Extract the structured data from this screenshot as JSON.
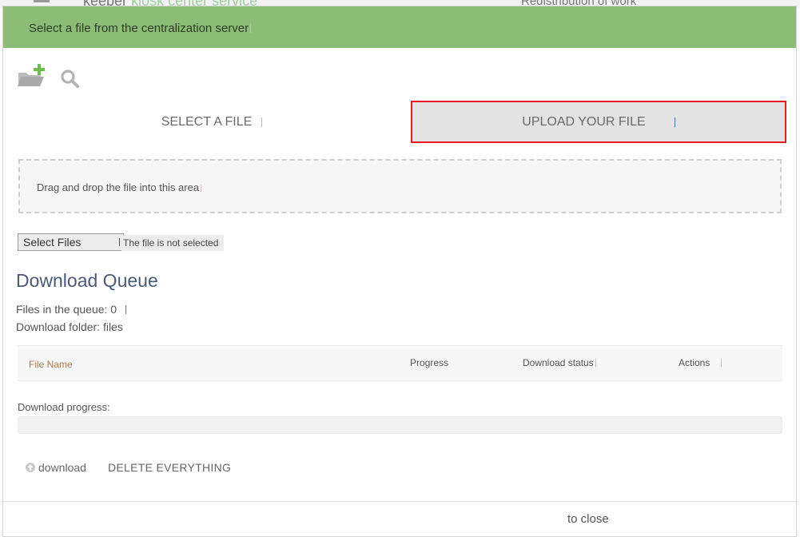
{
  "background": {
    "app_name": "keeper",
    "app_name_faded": "kiosk center service",
    "right_text": "Redistribution of work"
  },
  "modal": {
    "title": "Select a file from the centralization server"
  },
  "toolbar": {
    "add_folder_icon": "folder-plus-icon",
    "search_icon": "search-icon"
  },
  "tabs": [
    {
      "label": "SELECT A FILE",
      "active": false
    },
    {
      "label": "UPLOAD YOUR FILE",
      "active": true
    }
  ],
  "dropzone": {
    "text": "Drag and drop the file into this area"
  },
  "file_input": {
    "button_label": "Select Files",
    "status": "The file is not selected"
  },
  "queue": {
    "heading": "Download Queue",
    "files_in_queue": "Files in the queue: 0",
    "download_folder": "Download folder: files",
    "columns": [
      "File Name",
      "Progress",
      "Download status",
      "Actions"
    ],
    "progress_label": "Download progress:",
    "progress_fraction": 0
  },
  "actions": {
    "download": "download",
    "delete_all": "DELETE EVERYTHING"
  },
  "footer": {
    "close": "to close"
  },
  "colors": {
    "header": "#8cbd76",
    "highlight": "#e81c22",
    "heading": "#4a5a78"
  }
}
